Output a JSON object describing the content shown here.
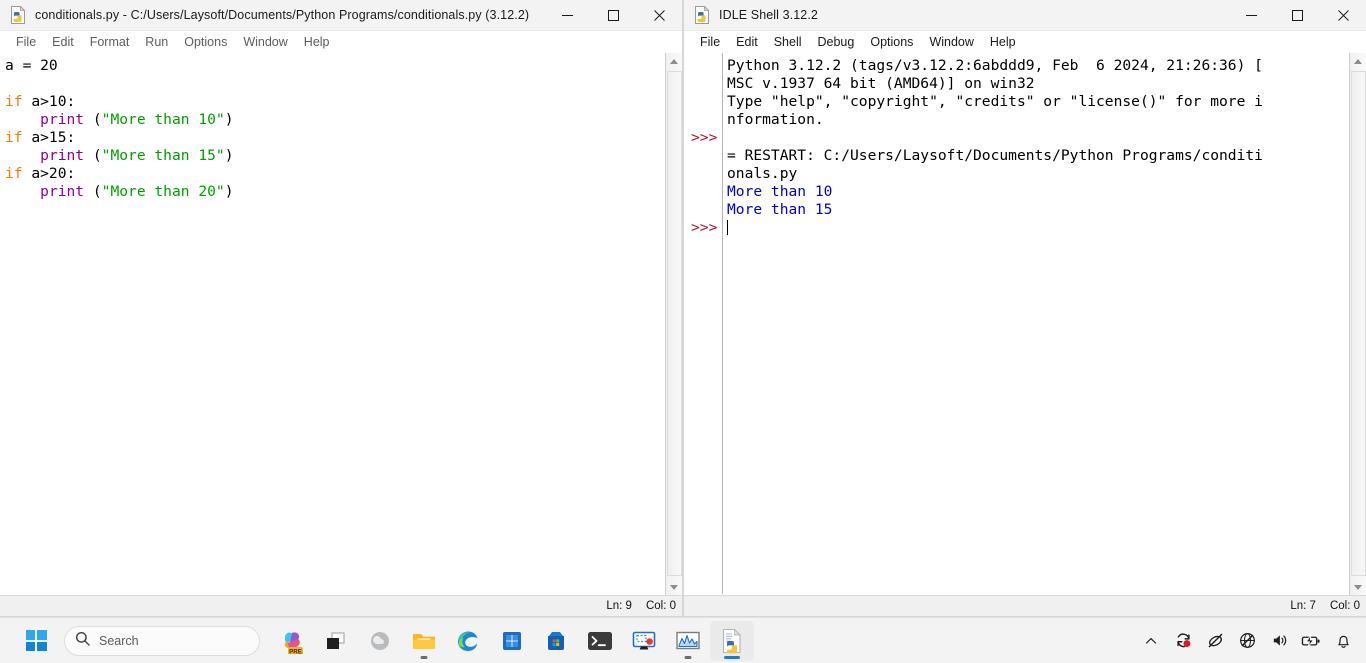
{
  "editor_window": {
    "icon": "python-file-icon",
    "title": "conditionals.py - C:/Users/Laysoft/Documents/Python Programs/conditionals.py (3.12.2)",
    "menu": [
      "File",
      "Edit",
      "Format",
      "Run",
      "Options",
      "Window",
      "Help"
    ],
    "controls": {
      "minimize": "minimize-icon",
      "maximize": "maximize-icon",
      "close": "close-icon"
    },
    "code_lines": [
      {
        "tokens": [
          {
            "t": "a = 20",
            "c": "plain"
          }
        ]
      },
      {
        "tokens": [
          {
            "t": "",
            "c": "plain"
          }
        ]
      },
      {
        "tokens": [
          {
            "t": "if",
            "c": "kw"
          },
          {
            "t": " a>10:",
            "c": "plain"
          }
        ]
      },
      {
        "tokens": [
          {
            "t": "    ",
            "c": "plain"
          },
          {
            "t": "print",
            "c": "builtin"
          },
          {
            "t": " (",
            "c": "plain"
          },
          {
            "t": "\"More than 10\"",
            "c": "str"
          },
          {
            "t": ")",
            "c": "plain"
          }
        ]
      },
      {
        "tokens": [
          {
            "t": "if",
            "c": "kw"
          },
          {
            "t": " a>15:",
            "c": "plain"
          }
        ]
      },
      {
        "tokens": [
          {
            "t": "    ",
            "c": "plain"
          },
          {
            "t": "print",
            "c": "builtin"
          },
          {
            "t": " (",
            "c": "plain"
          },
          {
            "t": "\"More than 15\"",
            "c": "str"
          },
          {
            "t": ")",
            "c": "plain"
          }
        ]
      },
      {
        "tokens": [
          {
            "t": "if",
            "c": "kw"
          },
          {
            "t": " a>20:",
            "c": "plain"
          }
        ]
      },
      {
        "tokens": [
          {
            "t": "    ",
            "c": "plain"
          },
          {
            "t": "print",
            "c": "builtin"
          },
          {
            "t": " (",
            "c": "plain"
          },
          {
            "t": "\"More than 20\"",
            "c": "str"
          },
          {
            "t": ")",
            "c": "plain"
          }
        ]
      }
    ],
    "status": {
      "line": "Ln: 9",
      "col": "Col: 0"
    }
  },
  "shell_window": {
    "icon": "python-idle-icon",
    "title": "IDLE Shell 3.12.2",
    "menu": [
      "File",
      "Edit",
      "Shell",
      "Debug",
      "Options",
      "Window",
      "Help"
    ],
    "controls": {
      "minimize": "minimize-icon",
      "maximize": "maximize-icon",
      "close": "close-icon"
    },
    "prompt_symbol": ">>>",
    "lines": [
      {
        "text": "Python 3.12.2 (tags/v3.12.2:6abddd9, Feb  6 2024, 21:26:36) [",
        "c": "plain"
      },
      {
        "text": "MSC v.1937 64 bit (AMD64)] on win32",
        "c": "plain"
      },
      {
        "text": "Type \"help\", \"copyright\", \"credits\" or \"license()\" for more i",
        "c": "plain"
      },
      {
        "text": "nformation.",
        "c": "plain"
      },
      {
        "text": "",
        "c": "plain"
      },
      {
        "text": "= RESTART: C:/Users/Laysoft/Documents/Python Programs/conditi",
        "c": "plain"
      },
      {
        "text": "onals.py",
        "c": "plain"
      },
      {
        "text": "More than 10",
        "c": "out"
      },
      {
        "text": "More than 15",
        "c": "out"
      },
      {
        "text": "",
        "c": "caret"
      }
    ],
    "prompt_rows": [
      4,
      9
    ],
    "status": {
      "line": "Ln: 7",
      "col": "Col: 0"
    }
  },
  "taskbar": {
    "start": "windows-start-icon",
    "search": {
      "icon": "search-icon",
      "placeholder": "Search"
    },
    "apps": [
      {
        "name": "copilot-icon",
        "badge": "PRE",
        "active": false
      },
      {
        "name": "task-view-icon",
        "active": false
      },
      {
        "name": "weather-widget-icon",
        "active": false
      },
      {
        "name": "file-explorer-icon",
        "active": true
      },
      {
        "name": "microsoft-edge-icon",
        "active": false
      },
      {
        "name": "office-icon",
        "active": false
      },
      {
        "name": "microsoft-store-icon",
        "active": false
      },
      {
        "name": "windows-terminal-icon",
        "active": false
      },
      {
        "name": "screen-recorder-icon",
        "active": false
      },
      {
        "name": "performance-monitor-icon",
        "active": true
      },
      {
        "name": "python-idle-icon",
        "active": true,
        "focused": true
      }
    ],
    "tray": [
      "chevron-up-icon",
      "sync-alert-icon",
      "pen-off-icon",
      "network-offline-icon",
      "volume-icon",
      "battery-charging-icon",
      "notification-bell-icon"
    ]
  },
  "colors": {
    "keyword": "#ff7700",
    "builtin": "#900090",
    "string": "#00a000",
    "output": "#0000cf",
    "prompt": "#b2132f",
    "accent": "#0c7fd6"
  }
}
